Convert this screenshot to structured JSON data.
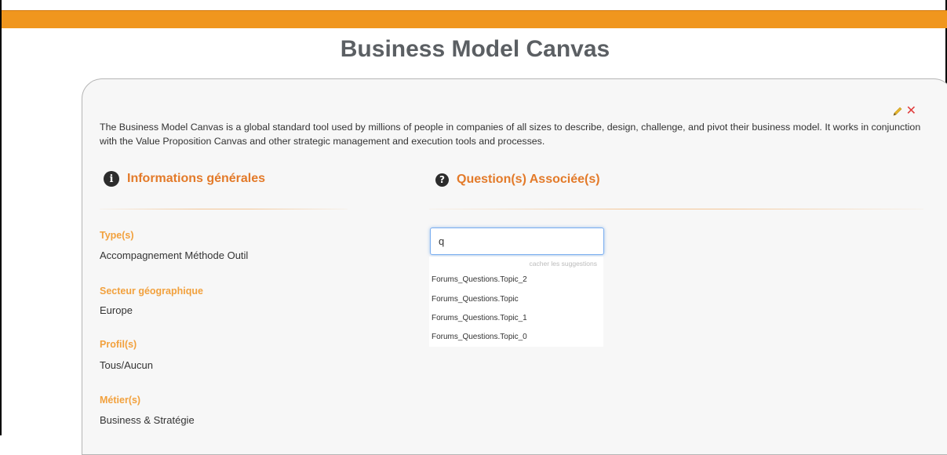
{
  "page": {
    "title": "Business Model Canvas"
  },
  "card": {
    "description": "The Business Model Canvas is a global standard tool used by millions of people in companies of all sizes to describe, design, challenge, and pivot their business model. It works in conjunction with the Value Proposition Canvas and other strategic management and execution tools and processes.",
    "actions": {
      "edit_icon": "pencil-icon",
      "close_icon": "close-icon",
      "close_glyph": "✕"
    }
  },
  "info": {
    "heading": "Informations générales",
    "icon": "info-icon",
    "icon_glyph": "i",
    "fields": [
      {
        "label": "Type(s)",
        "value": "Accompagnement Méthode Outil"
      },
      {
        "label": "Secteur géographique",
        "value": "Europe"
      },
      {
        "label": "Profil(s)",
        "value": "Tous/Aucun"
      },
      {
        "label": "Métier(s)",
        "value": "Business & Stratégie"
      }
    ]
  },
  "questions": {
    "heading": "Question(s) Associée(s)",
    "icon": "question-icon",
    "icon_glyph": "?",
    "search": {
      "value": "q",
      "placeholder": ""
    },
    "hide_suggestions": "cacher les suggestions",
    "suggestions": [
      "Forums_Questions.Topic_2",
      "Forums_Questions.Topic",
      "Forums_Questions.Topic_1",
      "Forums_Questions.Topic_0"
    ]
  },
  "colors": {
    "accent_orange": "#f0961e",
    "heading_orange": "#e37a29",
    "label_orange": "#f2a13d",
    "close_red": "#e03c3c"
  }
}
